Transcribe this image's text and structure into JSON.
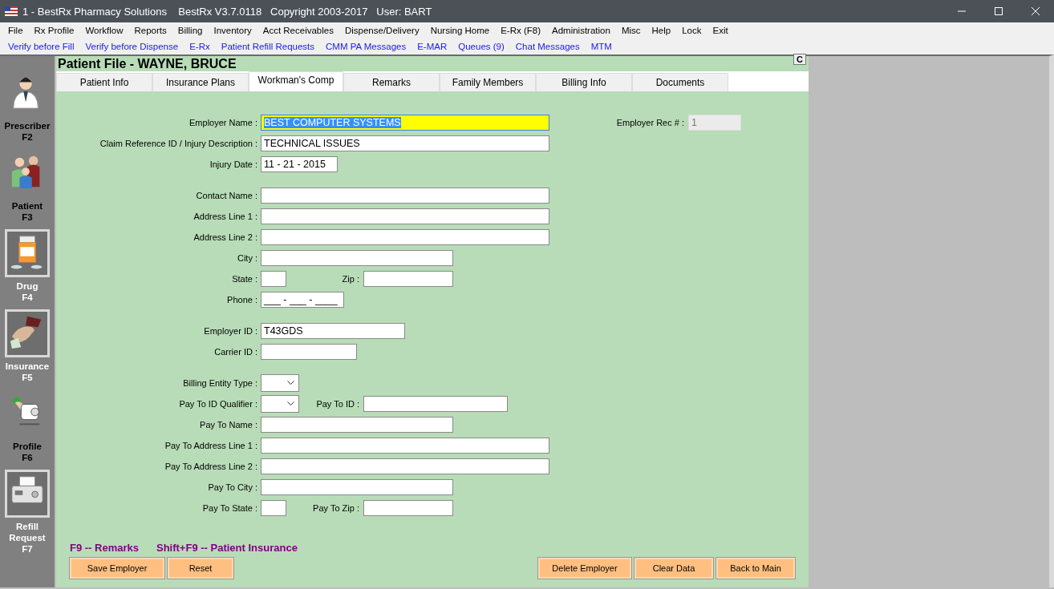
{
  "window": {
    "title": "1 - BestRx Pharmacy Solutions    BestRx V3.7.0118   Copyright 2003-2017   User: BART"
  },
  "menu": [
    "File",
    "Rx Profile",
    "Workflow",
    "Reports",
    "Billing",
    "Inventory",
    "Acct Receivables",
    "Dispense/Delivery",
    "Nursing Home",
    "E-Rx (F8)",
    "Administration",
    "Misc",
    "Help",
    "Lock",
    "Exit"
  ],
  "quick_links": [
    "Verify before Fill",
    "Verify before Dispense",
    "E-Rx",
    "Patient Refill Requests",
    "CMM PA Messages",
    "E-MAR",
    "Queues (9)",
    "Chat Messages",
    "MTM"
  ],
  "sidebar": {
    "items": [
      {
        "kind": "prescriber",
        "label": "Prescriber",
        "key": "F2",
        "framed": false
      },
      {
        "kind": "patient",
        "label": "Patient",
        "key": "F3",
        "framed": false
      },
      {
        "kind": "drug",
        "label": "Drug",
        "key": "F4",
        "framed": true
      },
      {
        "kind": "insurance",
        "label": "Insurance",
        "key": "F5",
        "framed": true
      },
      {
        "kind": "profile",
        "label": "Profile",
        "key": "F6",
        "framed": false
      },
      {
        "kind": "refill",
        "label": "Refill Request",
        "key": "F7",
        "framed": true
      }
    ]
  },
  "panel": {
    "title": "Patient File - WAYNE, BRUCE",
    "corner_button": "C",
    "tabs": [
      {
        "label": "Patient Info",
        "selected": false
      },
      {
        "label": "Insurance Plans",
        "selected": false
      },
      {
        "label": "Workman's Comp",
        "selected": true
      },
      {
        "label": "Remarks",
        "selected": false
      },
      {
        "label": "Family Members",
        "selected": false
      },
      {
        "label": "Billing Info",
        "selected": false
      },
      {
        "label": "Documents",
        "selected": false
      }
    ],
    "sections": [
      [
        [
          {
            "label": "Employer Name :",
            "value": "BEST COMPUTER SYSTEMS",
            "kind": "text",
            "focused": true
          },
          {
            "label": "Employer Rec # :",
            "value": "1",
            "kind": "text",
            "disabled": true
          }
        ],
        [
          {
            "label": "Claim Reference ID / Injury Description :",
            "value": "TECHNICAL ISSUES",
            "kind": "text"
          }
        ],
        [
          {
            "label": "Injury Date :",
            "value": "11 - 21 - 2015",
            "kind": "text"
          }
        ]
      ],
      [
        [
          {
            "label": "Contact Name :",
            "kind": "text"
          }
        ],
        [
          {
            "label": "Address Line 1 :",
            "kind": "text"
          }
        ],
        [
          {
            "label": "Address Line 2 :",
            "kind": "text"
          }
        ],
        [
          {
            "label": "City :",
            "kind": "text"
          }
        ],
        [
          {
            "label": "State :",
            "kind": "text"
          },
          {
            "label": "Zip :",
            "kind": "text"
          }
        ],
        [
          {
            "label": "Phone :",
            "value": "___ - ___ - ____",
            "kind": "text"
          }
        ]
      ],
      [
        [
          {
            "label": "Employer ID :",
            "value": "T43GDS",
            "kind": "text"
          }
        ],
        [
          {
            "label": "Carrier ID :",
            "kind": "text"
          }
        ]
      ],
      [
        [
          {
            "label": "Billing Entity Type :",
            "kind": "select"
          }
        ],
        [
          {
            "label": "Pay To ID Qualifier :",
            "kind": "select"
          },
          {
            "label": "Pay To ID :",
            "kind": "text"
          }
        ],
        [
          {
            "label": "Pay To Name :",
            "kind": "text"
          }
        ],
        [
          {
            "label": "Pay To Address Line 1 :",
            "kind": "text"
          }
        ],
        [
          {
            "label": "Pay To Address Line 2 :",
            "kind": "text"
          }
        ],
        [
          {
            "label": "Pay To City :",
            "kind": "text"
          }
        ],
        [
          {
            "label": "Pay To State :",
            "kind": "text"
          },
          {
            "label": "Pay To Zip :",
            "kind": "text"
          }
        ]
      ]
    ],
    "hints": [
      "F9 -- Remarks",
      "Shift+F9 -- Patient Insurance"
    ],
    "buttons_left": [
      "Save Employer",
      "Reset"
    ],
    "buttons_right": [
      "Delete Employer",
      "Clear Data",
      "Back to Main"
    ]
  }
}
